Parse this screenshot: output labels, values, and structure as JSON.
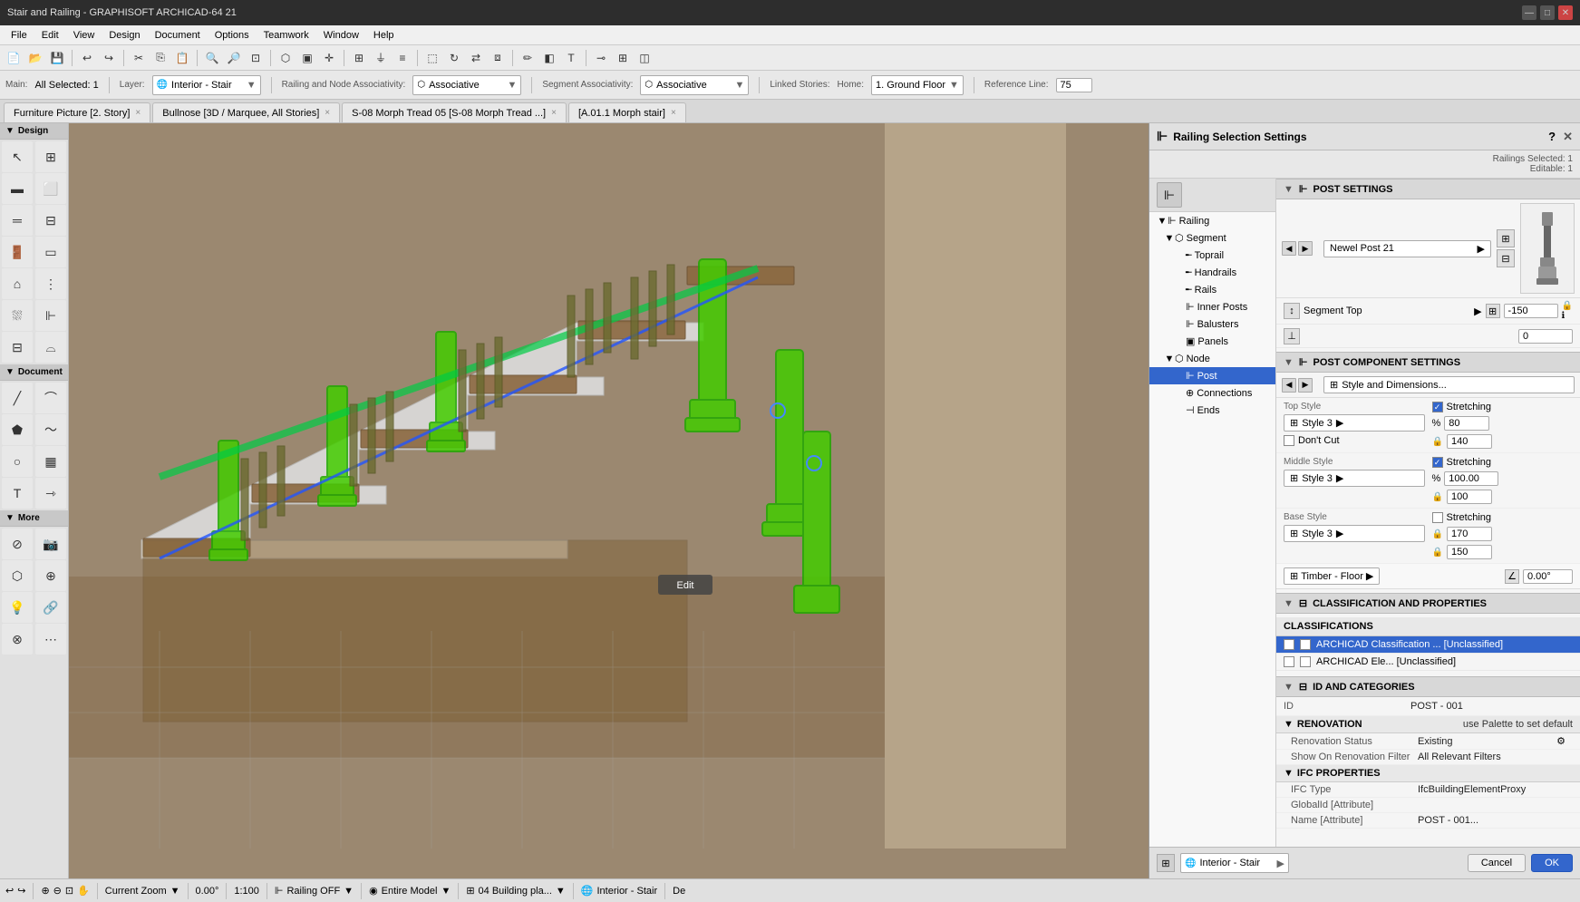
{
  "titlebar": {
    "title": "Stair and Railing - GRAPHISOFT ARCHICAD-64 21",
    "min": "—",
    "max": "□",
    "close": "✕"
  },
  "menubar": {
    "items": [
      "File",
      "Edit",
      "View",
      "Design",
      "Document",
      "Options",
      "Teamwork",
      "Window",
      "Help"
    ]
  },
  "context": {
    "main_label": "Main:",
    "all_selected_label": "All Selected: 1",
    "layer_label": "Layer:",
    "layer_value": "Interior - Stair",
    "railing_assoc_label": "Railing and Node Associativity:",
    "railing_assoc_value": "Associative",
    "segment_assoc_label": "Segment Associativity:",
    "segment_assoc_value": "Associative",
    "linked_stories_label": "Linked Stories:",
    "linked_stories_home": "Home:",
    "linked_stories_value": "1. Ground Floor",
    "ref_line_label": "Reference Line:",
    "ref_line_value": "75"
  },
  "tabs": [
    {
      "label": "Furniture Picture [2. Story]",
      "active": false,
      "closeable": true
    },
    {
      "label": "Bullnose [3D / Marquee, All Stories]",
      "active": false,
      "closeable": true
    },
    {
      "label": "S-08 Morph Tread 05 [S-08 Morph Tread ...]",
      "active": false,
      "closeable": true
    },
    {
      "label": "[A.01.1 Morph stair]",
      "active": false,
      "closeable": true
    }
  ],
  "tree": {
    "items": [
      {
        "label": "Railing",
        "level": 0,
        "expanded": true,
        "icon": "railing-icon"
      },
      {
        "label": "Segment",
        "level": 1,
        "expanded": true,
        "icon": "segment-icon"
      },
      {
        "label": "Toprail",
        "level": 2,
        "expanded": false,
        "icon": "toprail-icon"
      },
      {
        "label": "Handrails",
        "level": 2,
        "expanded": false,
        "icon": "handrails-icon"
      },
      {
        "label": "Rails",
        "level": 2,
        "expanded": false,
        "icon": "rails-icon"
      },
      {
        "label": "Inner Posts",
        "level": 2,
        "expanded": false,
        "icon": "innerposts-icon"
      },
      {
        "label": "Balusters",
        "level": 2,
        "expanded": false,
        "icon": "balusters-icon"
      },
      {
        "label": "Panels",
        "level": 2,
        "expanded": false,
        "icon": "panels-icon"
      },
      {
        "label": "Node",
        "level": 1,
        "expanded": true,
        "icon": "node-icon"
      },
      {
        "label": "Post",
        "level": 2,
        "expanded": false,
        "icon": "post-icon",
        "selected": true
      },
      {
        "label": "Connections",
        "level": 2,
        "expanded": false,
        "icon": "connections-icon"
      },
      {
        "label": "Ends",
        "level": 2,
        "expanded": false,
        "icon": "ends-icon"
      }
    ]
  },
  "rss": {
    "title": "Railing Selection Settings",
    "header": "Railings Selected: 1",
    "subheader": "Editable: 1",
    "close_label": "✕",
    "help_label": "?"
  },
  "post_settings": {
    "section_label": "POST SETTINGS",
    "newel_post_label": "Newel Post 21",
    "segment_top_label": "Segment Top",
    "segment_top_value": "-150",
    "offset_value": "0"
  },
  "post_component": {
    "section_label": "POST COMPONENT SETTINGS",
    "style_dimensions_label": "Style and Dimensions...",
    "top_style_label": "Top Style",
    "top_style_value": "Style 3",
    "dont_cut_label": "Don't Cut",
    "stretching_label": "Stretching",
    "stretch_pct_top": "80",
    "stretch_val1": "140",
    "middle_style_label": "Middle Style",
    "middle_style_value": "Style 3",
    "stretching_middle_label": "Stretching",
    "stretch_pct_mid": "100.00",
    "stretch_val_mid": "100",
    "base_style_label": "Base Style",
    "base_style_value": "Style 3",
    "stretch_val_base1": "170",
    "stretch_val_base2": "150",
    "timber_label": "Timber - Floor",
    "angle_label": "0.00°"
  },
  "classification": {
    "section_label": "CLASSIFICATION AND PROPERTIES",
    "classifs_label": "CLASSIFICATIONS",
    "classif1": "ARCHICAD Classification ... [Unclassified]",
    "classif2": "ARCHICAD Ele... [Unclassified]"
  },
  "id_categories": {
    "section_label": "ID AND CATEGORIES",
    "id_label": "ID",
    "id_value": "POST - 001",
    "renovation_label": "RENOVATION",
    "renovation_value": "use Palette to set default",
    "renovation_status_label": "Renovation Status",
    "renovation_status_value": "Existing",
    "show_renovation_label": "Show On Renovation Filter",
    "show_renovation_value": "All Relevant Filters",
    "ifc_label": "IFC PROPERTIES",
    "ifc_type_label": "IFC Type",
    "ifc_type_value": "IfcBuildingElementProxy",
    "globalid_label": "GlobalId [Attribute]",
    "globalid_value": "",
    "name_label": "Name [Attribute]",
    "name_value": "POST - 001..."
  },
  "statusbar": {
    "current_zoom_label": "Current Zoom",
    "zoom_value": "0.00°",
    "scale_value": "1:100",
    "railing_off": "Railing OFF",
    "entire_model": "Entire Model",
    "story": "04 Building pla...",
    "interior_stair": "Interior - Stair",
    "edit_mode": "De"
  },
  "footer": {
    "cancel_label": "Cancel",
    "ok_label": "OK",
    "interior_stair": "Interior - Stair"
  },
  "canvas": {
    "edit_button": "Edit"
  }
}
